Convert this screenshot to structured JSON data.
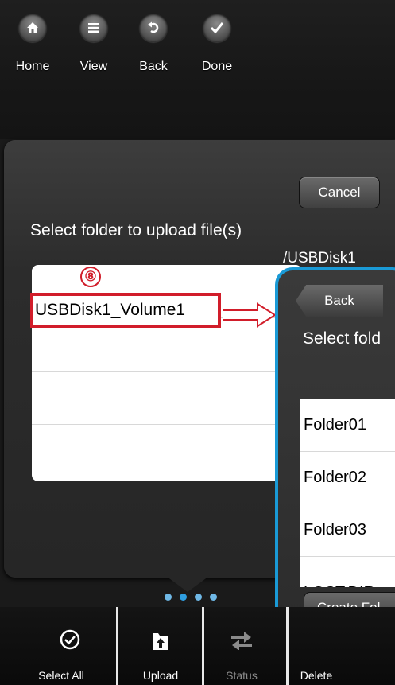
{
  "toolbar": {
    "items": [
      {
        "label": "Home",
        "icon": "home-icon"
      },
      {
        "label": "View",
        "icon": "list-icon"
      },
      {
        "label": "Back",
        "icon": "undo-icon"
      },
      {
        "label": "Done",
        "icon": "check-icon"
      }
    ]
  },
  "dialog": {
    "cancel_label": "Cancel",
    "title": "Select folder to upload file(s)",
    "step_marker": "⑧",
    "volumes": [
      "USBDisk1_Volume1"
    ]
  },
  "panel2": {
    "path": "/USBDisk1",
    "back_label": "Back",
    "title": "Select fold",
    "folders": [
      "Folder01",
      "Folder02",
      "Folder03",
      "LOST.DIR"
    ],
    "create_label": "Create Fol"
  },
  "tabbar": {
    "items": [
      {
        "label": "Select All",
        "icon": "select-all-icon",
        "enabled": true
      },
      {
        "label": "Upload",
        "icon": "upload-icon",
        "enabled": true
      },
      {
        "label": "Status",
        "icon": "transfer-status-icon",
        "enabled": false
      },
      {
        "label": "Delete",
        "icon": "delete-icon",
        "enabled": true
      }
    ]
  },
  "colors": {
    "highlight_red": "#d11d2a",
    "panel_border_blue": "#1a9ad6",
    "page_dot_blue": "#2f9ee0"
  }
}
